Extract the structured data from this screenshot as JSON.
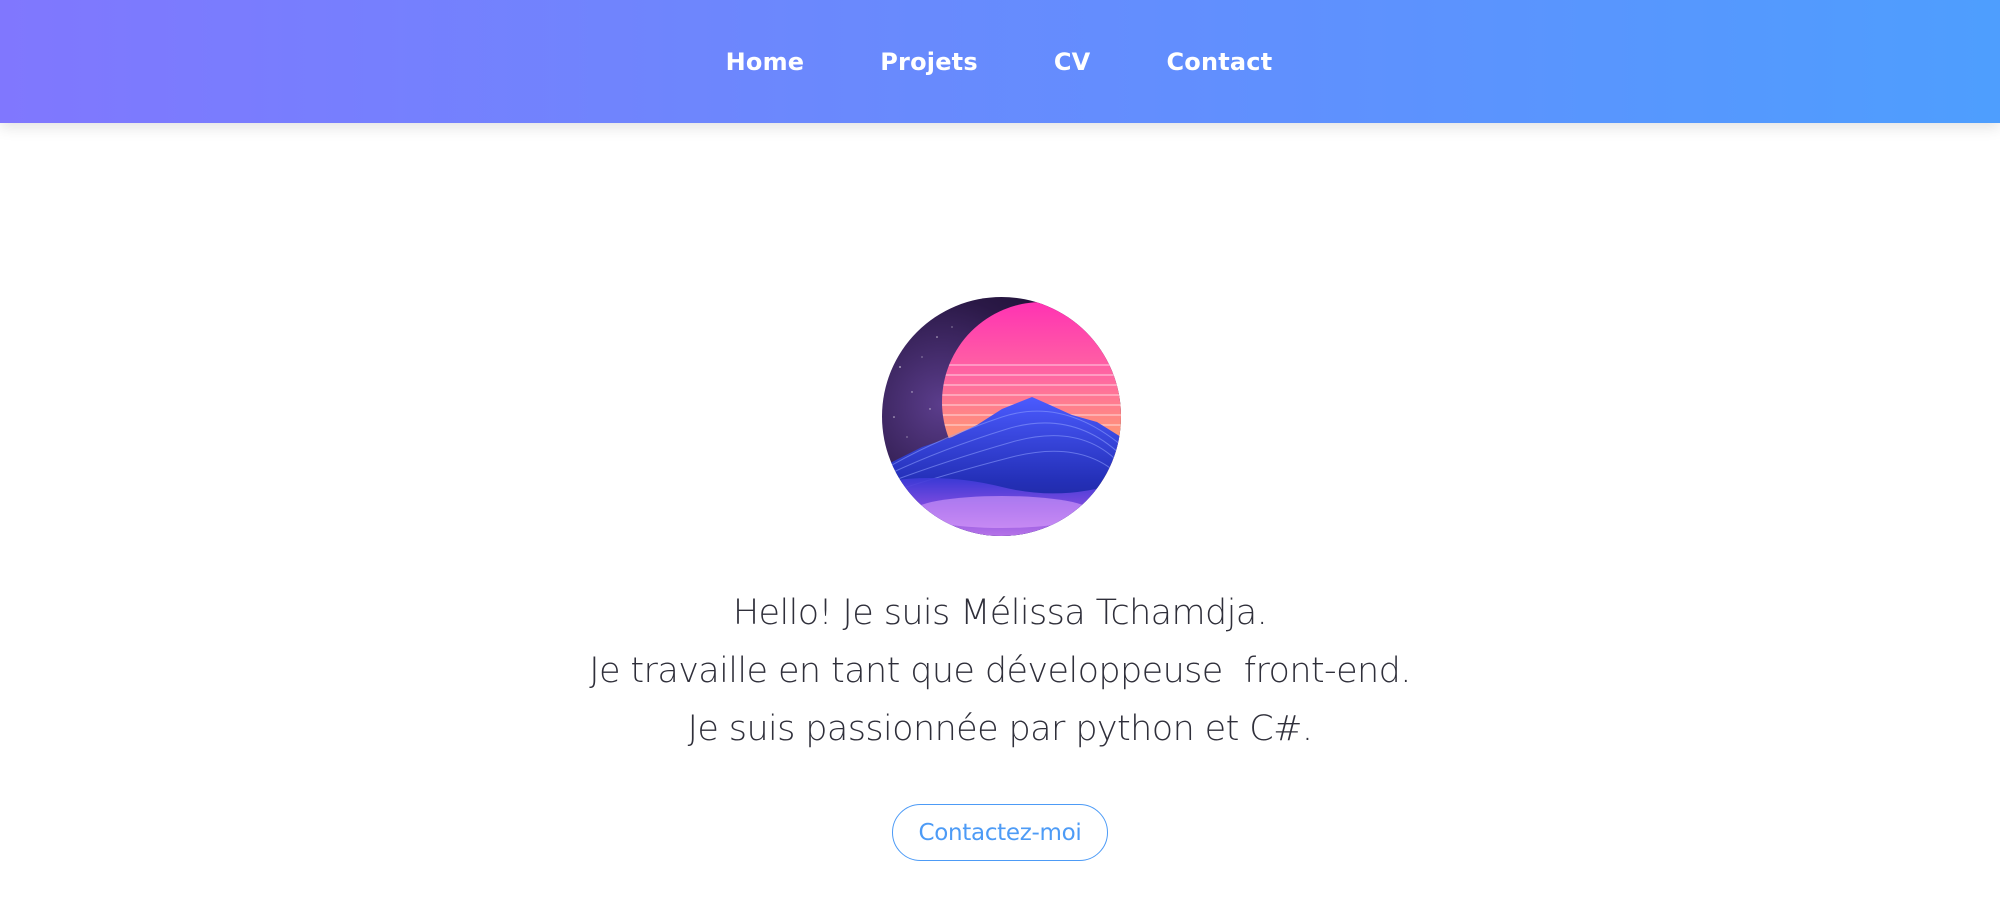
{
  "nav": {
    "items": [
      {
        "label": "Home"
      },
      {
        "label": "Projets"
      },
      {
        "label": "CV"
      },
      {
        "label": "Contact"
      }
    ]
  },
  "hero": {
    "avatar_icon": "retro-sunset-mountain-avatar",
    "intro_lines": [
      "Hello! Je suis Mélissa Tchamdja.",
      "Je travaille en tant que développeuse  front-end.",
      "Je suis passionnée par python et C#."
    ],
    "cta_label": "Contactez-moi"
  },
  "colors": {
    "nav_gradient_start": "#8077fe",
    "nav_gradient_end": "#4e9efe",
    "accent": "#4d9bf6",
    "text": "#2f2f3a"
  }
}
